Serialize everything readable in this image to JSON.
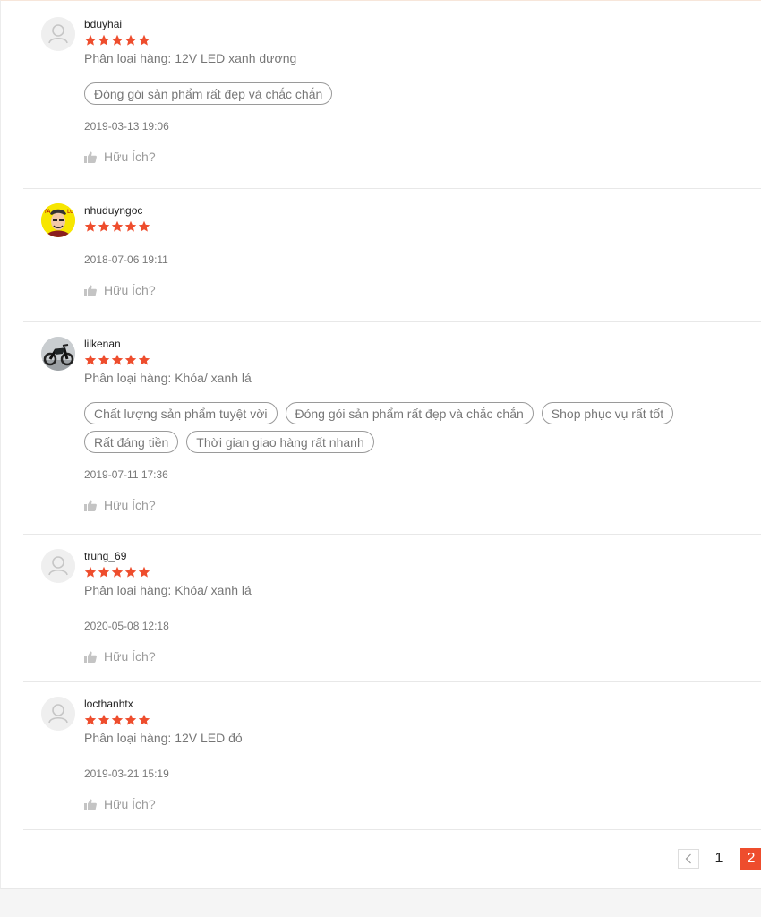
{
  "colors": {
    "accent": "#ee4d2d",
    "star": "#ee4d2d"
  },
  "reviews": [
    {
      "username": "bduyhai",
      "rating": 5,
      "avatar": "default-avatar-icon",
      "variation": "Phân loại hàng: 12V LED xanh dương",
      "tags": [
        "Đóng gói sản phẩm rất đẹp và chắc chắn"
      ],
      "date": "2019-03-13 19:06",
      "helpful": "Hữu Ích?"
    },
    {
      "username": "nhuduyngoc",
      "rating": 5,
      "avatar": "cartoon-avatar-image",
      "variation": "",
      "tags": [],
      "date": "2018-07-06 19:11",
      "helpful": "Hữu Ích?"
    },
    {
      "username": "lilkenan",
      "rating": 5,
      "avatar": "motorbike-avatar-image",
      "variation": "Phân loại hàng: Khóa/ xanh lá",
      "tags": [
        "Chất lượng sản phẩm tuyệt vời",
        "Đóng gói sản phẩm rất đẹp và chắc chắn",
        "Shop phục vụ rất tốt",
        "Rất đáng tiền",
        "Thời gian giao hàng rất nhanh"
      ],
      "date": "2019-07-11 17:36",
      "helpful": "Hữu Ích?"
    },
    {
      "username": "trung_69",
      "rating": 5,
      "avatar": "default-avatar-icon",
      "variation": "Phân loại hàng: Khóa/ xanh lá",
      "tags": [],
      "date": "2020-05-08 12:18",
      "helpful": "Hữu Ích?"
    },
    {
      "username": "locthanhtx",
      "rating": 5,
      "avatar": "default-avatar-icon",
      "variation": "Phân loại hàng: 12V LED đỏ",
      "tags": [],
      "date": "2019-03-21 15:19",
      "helpful": "Hữu Ích?"
    }
  ],
  "pagination": {
    "prev_icon": "chevron-left-icon",
    "pages": [
      "1",
      "2"
    ],
    "current": "2"
  }
}
